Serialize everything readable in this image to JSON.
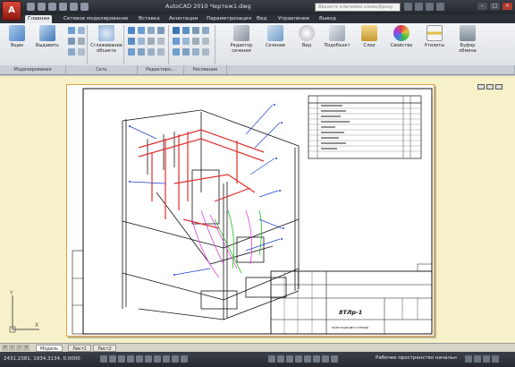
{
  "app": {
    "logo_letter": "A",
    "title": "AutoCAD 2010   Чертеж1.dwg",
    "search_placeholder": "Введите ключевое слово/фразу"
  },
  "ribbon_tabs": [
    {
      "label": "Главная",
      "active": true
    },
    {
      "label": "Сетевое моделирование"
    },
    {
      "label": "Вставка"
    },
    {
      "label": "Аннотации"
    },
    {
      "label": "Параметризация"
    },
    {
      "label": "Вид"
    },
    {
      "label": "Управление"
    },
    {
      "label": "Вывод"
    }
  ],
  "ribbon": {
    "items": [
      {
        "label": "Ящик",
        "icon": "box-icon",
        "color": "#6aa0d8"
      },
      {
        "label": "Выдавить",
        "icon": "extrude-icon",
        "color": "#4f86c6"
      },
      {
        "label": "Сглаживание объекта",
        "icon": "smooth-object-icon",
        "color": "#8fb3d9"
      },
      {
        "label": "Редактор сечения",
        "icon": "section-editor-icon",
        "color": "#9aa3ad"
      },
      {
        "label": "Сечение",
        "icon": "section-icon",
        "color": "#7ea7c9"
      },
      {
        "label": "Вид",
        "icon": "view-icon",
        "color": "#c7cdd3"
      },
      {
        "label": "Подобъект",
        "icon": "subobject-icon",
        "color": "#aeb8c2"
      },
      {
        "label": "Слои",
        "icon": "layers-icon",
        "color": "#d6b25a"
      },
      {
        "label": "Свойства",
        "icon": "properties-icon",
        "color": "#d84a4a"
      },
      {
        "label": "Утилиты",
        "icon": "utilities-icon",
        "color": "#e0c040"
      },
      {
        "label": "Буфер обмена",
        "icon": "clipboard-icon",
        "color": "#8a9aaa"
      }
    ],
    "panels": [
      {
        "label": "Моделирование"
      },
      {
        "label": "Сеть"
      },
      {
        "label": "Редактиро..."
      },
      {
        "label": "Рисование"
      }
    ]
  },
  "drawing": {
    "stamp_code": "8ТЛр-1",
    "stamp_title": "конструкция стенда",
    "colors": {
      "frame": "#111111",
      "red": "#e03030",
      "green": "#20c020",
      "magenta": "#e040e0",
      "blue": "#2040d0",
      "border": "#e2a23c"
    }
  },
  "layout_tabs": [
    {
      "label": "Модель",
      "active": true
    },
    {
      "label": "Лист1"
    },
    {
      "label": "Лист2"
    }
  ],
  "status": {
    "coords": "2431.2381, 1934.3134, 0.0000",
    "workspace": "Рабочее пространство начальн"
  }
}
